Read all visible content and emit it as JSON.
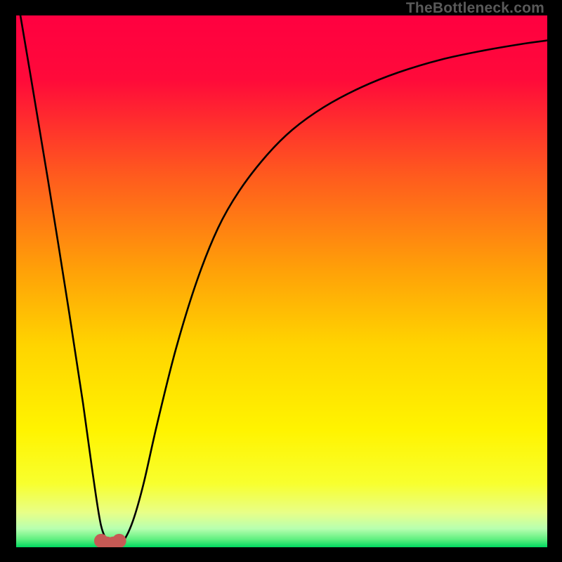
{
  "attribution": "TheBottleneck.com",
  "chart_data": {
    "type": "line",
    "title": "",
    "xlabel": "",
    "ylabel": "",
    "xlim": [
      0,
      100
    ],
    "ylim": [
      0,
      100
    ],
    "grid": false,
    "gradient_stops": [
      {
        "offset": 0.0,
        "color": "#ff0040"
      },
      {
        "offset": 0.12,
        "color": "#ff0a3a"
      },
      {
        "offset": 0.3,
        "color": "#ff5a1e"
      },
      {
        "offset": 0.48,
        "color": "#ffa108"
      },
      {
        "offset": 0.62,
        "color": "#ffd400"
      },
      {
        "offset": 0.78,
        "color": "#fff400"
      },
      {
        "offset": 0.88,
        "color": "#f8ff2e"
      },
      {
        "offset": 0.935,
        "color": "#e8ff88"
      },
      {
        "offset": 0.965,
        "color": "#b8ffb0"
      },
      {
        "offset": 0.985,
        "color": "#60f080"
      },
      {
        "offset": 1.0,
        "color": "#00d860"
      }
    ],
    "series": [
      {
        "name": "bottleneck-curve",
        "color": "#000000",
        "x": [
          0.8,
          3,
          6,
          10,
          12.6,
          14.4,
          16,
          17.5,
          18.7,
          20.2,
          22,
          24,
          26.5,
          30,
          34,
          38,
          42,
          47,
          52,
          58,
          65,
          72,
          80,
          88,
          95,
          100
        ],
        "y": [
          100,
          87,
          69,
          44,
          27,
          14,
          4,
          1,
          0.5,
          1.2,
          5,
          12,
          23,
          37,
          50,
          60,
          67,
          73.5,
          78.5,
          82.8,
          86.5,
          89.3,
          91.7,
          93.4,
          94.6,
          95.3
        ]
      }
    ],
    "markers": {
      "name": "min-lobe",
      "color": "#c65a55",
      "radius_px": 10,
      "x": [
        16.0,
        17.1,
        18.3,
        19.4
      ],
      "y": [
        1.2,
        0.7,
        0.7,
        1.2
      ]
    }
  }
}
